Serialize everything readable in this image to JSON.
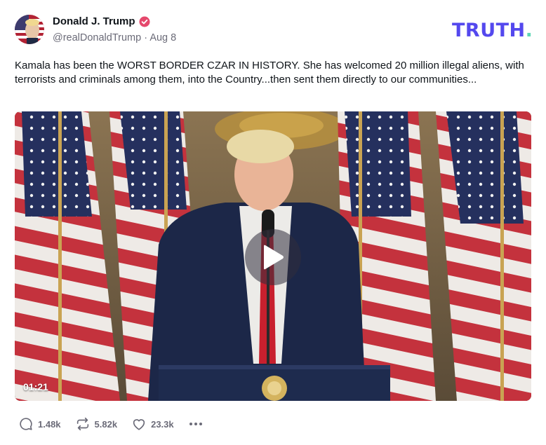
{
  "author": {
    "name": "Donald J. Trump",
    "handle": "@realDonaldTrump",
    "separator": "·",
    "date": "Aug 8",
    "verified_color": "#e5486c"
  },
  "brand": {
    "logo_text": "TRUTH",
    "logo_dot": ".",
    "color": "#5448ee",
    "dot_color": "#5ed6b5"
  },
  "post": {
    "text": "Kamala has been the WORST BORDER CZAR IN HISTORY. She has welcomed 20 million illegal aliens, with terrorists and criminals among them, into the Country...then sent them directly to our communities..."
  },
  "video": {
    "duration": "01:21",
    "play_icon": "play-icon"
  },
  "actions": {
    "replies": "1.48k",
    "retruths": "5.82k",
    "likes": "23.3k",
    "more_icon": "more-horizontal-icon"
  }
}
